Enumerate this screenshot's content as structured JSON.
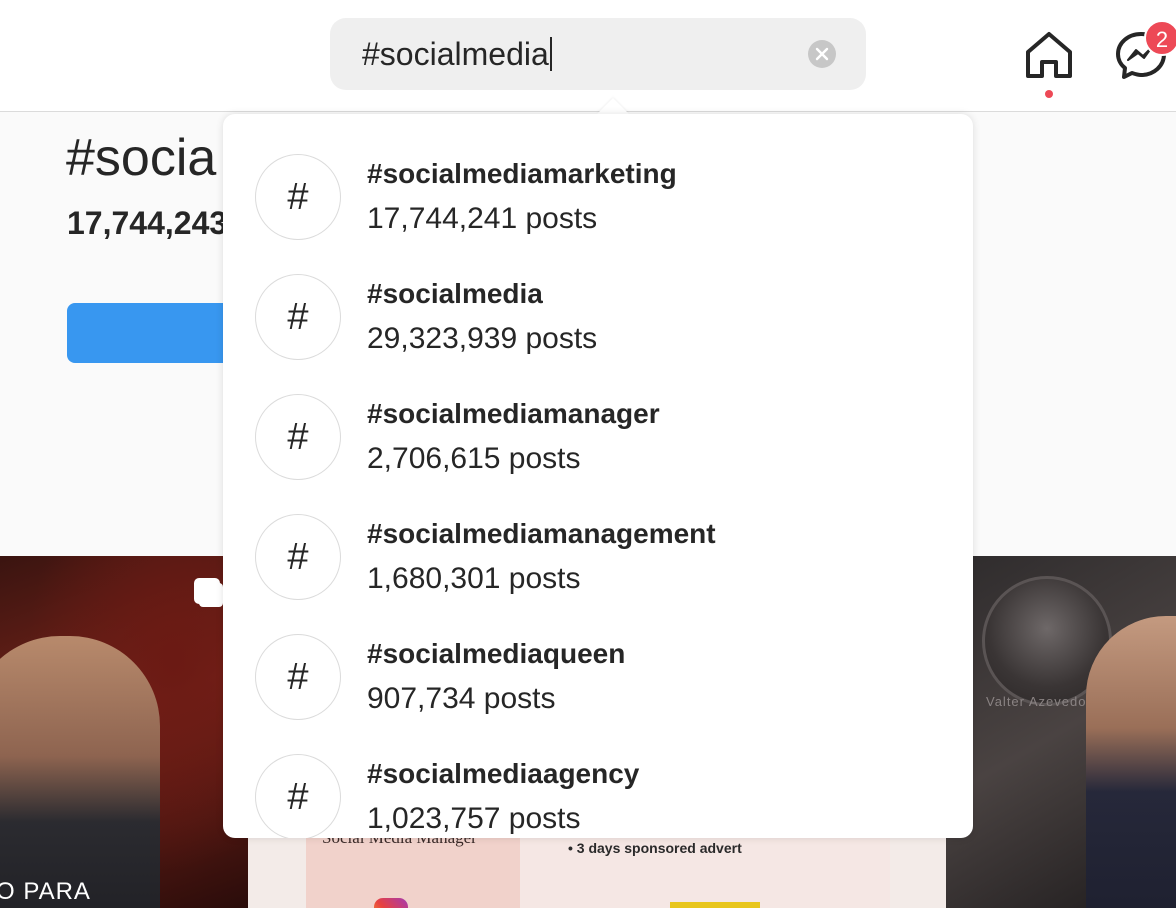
{
  "search": {
    "query": "#socialmedia"
  },
  "header": {
    "notification_badge": "2"
  },
  "page": {
    "title": "#socia",
    "post_count": "17,744,243"
  },
  "results": [
    {
      "tag": "#socialmediamarketing",
      "count": "17,744,241 posts"
    },
    {
      "tag": "#socialmedia",
      "count": "29,323,939 posts"
    },
    {
      "tag": "#socialmediamanager",
      "count": "2,706,615 posts"
    },
    {
      "tag": "#socialmediamanagement",
      "count": "1,680,301 posts"
    },
    {
      "tag": "#socialmediaqueen",
      "count": "907,734 posts"
    },
    {
      "tag": "#socialmediaagency",
      "count": "1,023,757 posts"
    }
  ],
  "result_icon": "#",
  "posts": {
    "post_1_caption": "O PARA",
    "post_2_title": "Social Media Manager",
    "post_2_note": "• 3 days sponsored advert",
    "post_3_name": "Valter Azevedo"
  },
  "colors": {
    "accent_blue": "#3897f0",
    "notification_red": "#ed4956",
    "text": "#262626"
  },
  "icons": [
    "home-icon",
    "messenger-icon",
    "clear-search-icon",
    "hashtag-icon",
    "multiple-posts-icon"
  ]
}
